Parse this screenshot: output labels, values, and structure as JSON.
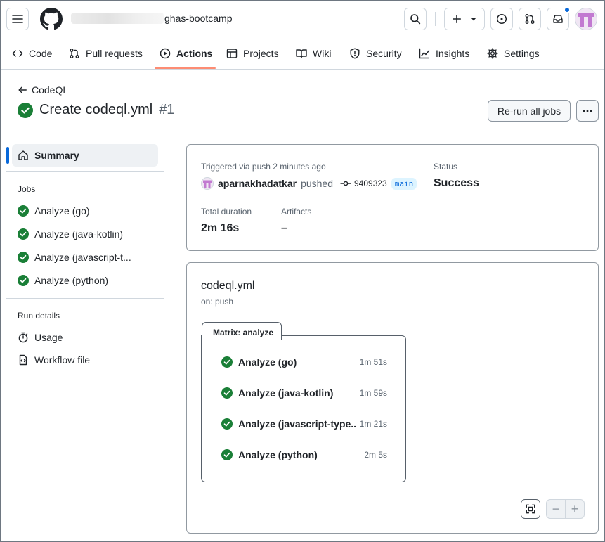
{
  "header": {
    "repo_name": "ghas-bootcamp"
  },
  "tabs": [
    {
      "label": "Code"
    },
    {
      "label": "Pull requests"
    },
    {
      "label": "Actions"
    },
    {
      "label": "Projects"
    },
    {
      "label": "Wiki"
    },
    {
      "label": "Security"
    },
    {
      "label": "Insights"
    },
    {
      "label": "Settings"
    }
  ],
  "page": {
    "back_label": "CodeQL",
    "title": "Create codeql.yml",
    "run_number": "#1",
    "rerun_label": "Re-run all jobs"
  },
  "sidebar": {
    "summary_label": "Summary",
    "jobs_heading": "Jobs",
    "jobs": [
      {
        "label": "Analyze (go)"
      },
      {
        "label": "Analyze (java-kotlin)"
      },
      {
        "label": "Analyze (javascript-t..."
      },
      {
        "label": "Analyze (python)"
      }
    ],
    "run_details_heading": "Run details",
    "usage_label": "Usage",
    "workflow_file_label": "Workflow file"
  },
  "summary": {
    "trigger_text": "Triggered via push 2 minutes ago",
    "actor": "aparnakhadatkar",
    "action": "pushed",
    "commit": "9409323",
    "branch": "main",
    "status_label": "Status",
    "status_value": "Success",
    "duration_label": "Total duration",
    "duration_value": "2m 16s",
    "artifacts_label": "Artifacts",
    "artifacts_value": "–"
  },
  "workflow": {
    "file": "codeql.yml",
    "on": "on: push",
    "matrix_label": "Matrix: analyze",
    "jobs": [
      {
        "name": "Analyze (go)",
        "duration": "1m 51s"
      },
      {
        "name": "Analyze (java-kotlin)",
        "duration": "1m 59s"
      },
      {
        "name": "Analyze (javascript-type...",
        "duration": "1m 21s"
      },
      {
        "name": "Analyze (python)",
        "duration": "2m 5s"
      }
    ],
    "zoom_out": "−",
    "zoom_in": "+"
  },
  "colors": {
    "success": "#1a7f37",
    "accent": "#0969da",
    "active_tab": "#fd8c73"
  }
}
